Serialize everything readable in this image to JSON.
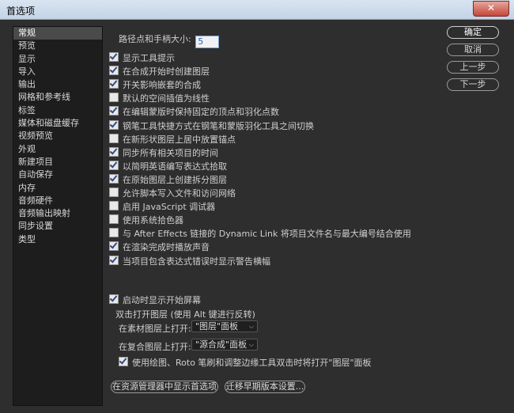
{
  "window": {
    "title": "首选项",
    "close_label": "✕"
  },
  "sidebar": {
    "items": [
      {
        "label": "常规",
        "selected": true
      },
      {
        "label": "预览"
      },
      {
        "label": "显示"
      },
      {
        "label": "导入"
      },
      {
        "label": "输出"
      },
      {
        "label": "网格和参考线"
      },
      {
        "label": "标签"
      },
      {
        "label": "媒体和磁盘缓存"
      },
      {
        "label": "视频预览"
      },
      {
        "label": "外观"
      },
      {
        "label": "新建项目"
      },
      {
        "label": "自动保存"
      },
      {
        "label": "内存"
      },
      {
        "label": "音频硬件"
      },
      {
        "label": "音频输出映射"
      },
      {
        "label": "同步设置"
      },
      {
        "label": "类型"
      }
    ]
  },
  "general": {
    "path_point_label": "路径点和手柄大小:",
    "path_point_value": "5",
    "options": [
      {
        "label": "显示工具提示",
        "checked": true
      },
      {
        "label": "在合成开始时创建图层",
        "checked": true
      },
      {
        "label": "开关影响嵌套的合成",
        "checked": true
      },
      {
        "label": "默认的空间插值为线性",
        "checked": false
      },
      {
        "label": "在编辑蒙版时保持固定的顶点和羽化点数",
        "checked": true
      },
      {
        "label": "钢笔工具快捷方式在钢笔和蒙版羽化工具之间切换",
        "checked": true
      },
      {
        "label": "在新形状图层上居中放置锚点",
        "checked": false
      },
      {
        "label": "同步所有相关项目的时间",
        "checked": true
      },
      {
        "label": "以简明英语编写表达式拾取",
        "checked": true
      },
      {
        "label": "在原始图层上创建拆分图层",
        "checked": true
      },
      {
        "label": "允许脚本写入文件和访问网络",
        "checked": false
      },
      {
        "label": "启用 JavaScript 调试器",
        "checked": false
      },
      {
        "label": "使用系统拾色器",
        "checked": false
      },
      {
        "label": "与 After Effects 链接的 Dynamic Link 将项目文件名与最大编号结合使用",
        "checked": false
      },
      {
        "label": "在渲染完成时播放声音",
        "checked": true
      },
      {
        "label": "当项目包含表达式错误时显示警告横幅",
        "checked": true
      }
    ],
    "startup_label": "启动时显示开始屏幕",
    "startup_checked": true,
    "double_click_title": "双击打开图层 (使用 Alt 键进行反转)",
    "footage_label": "在素材图层上打开:",
    "footage_value": "\"图层\"面板",
    "comp_label": "在复合图层上打开:",
    "comp_value": "\"源合成\"面板",
    "paint_label": "使用绘图、Roto 笔刷和调整边缘工具双击时将打开\"图层\"面板",
    "paint_checked": true,
    "reveal_button": "在资源管理器中显示首选项",
    "migrate_button": "迁移早期版本设置..."
  },
  "buttons": {
    "ok": "确定",
    "cancel": "取消",
    "prev": "上一步",
    "next": "下一步"
  }
}
